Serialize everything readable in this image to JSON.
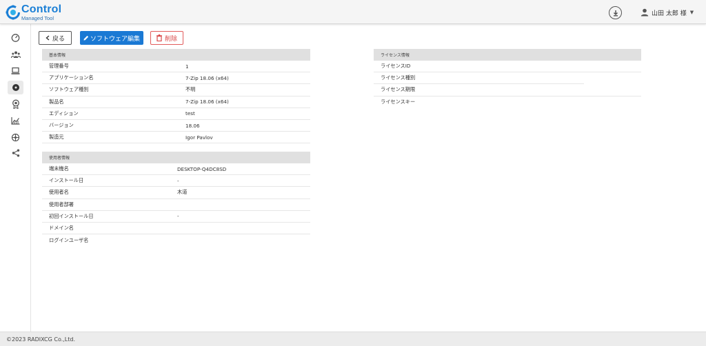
{
  "header": {
    "logo_title": "Control",
    "logo_sub": "Managed Tool",
    "user_name": "山田 太郎 様"
  },
  "colors": {
    "primary": "#1a79d4",
    "danger": "#d94848",
    "panel_head": "#e0e0e0"
  },
  "sidebar": {
    "items": [
      {
        "icon": "dashboard-gauge-icon"
      },
      {
        "icon": "users-group-icon"
      },
      {
        "icon": "laptop-icon"
      },
      {
        "icon": "software-disc-icon",
        "active": true
      },
      {
        "icon": "license-badge-icon"
      },
      {
        "icon": "report-chart-icon"
      },
      {
        "icon": "network-globe-icon"
      },
      {
        "icon": "share-icon"
      }
    ]
  },
  "toolbar": {
    "back_label": "戻る",
    "edit_label": "ソフトウェア編集",
    "delete_label": "削除"
  },
  "basic_info": {
    "title": "基本情報",
    "rows": [
      {
        "label": "管理番号",
        "value": "1"
      },
      {
        "label": "アプリケーション名",
        "value": "7-Zip 18.06 (x64)"
      },
      {
        "label": "ソフトウェア種別",
        "value": "不明"
      },
      {
        "label": "製品名",
        "value": "7-Zip 18.06 (x64)"
      },
      {
        "label": "エディション",
        "value": "test"
      },
      {
        "label": "バージョン",
        "value": "18.06"
      },
      {
        "label": "製造元",
        "value": "Igor Pavlov"
      }
    ]
  },
  "usage_info": {
    "title": "使用者情報",
    "rows": [
      {
        "label": "端末機名",
        "value": "DESKTOP-Q4DC8SD"
      },
      {
        "label": "インストール日",
        "value": "-"
      },
      {
        "label": "使用者名",
        "value": "木道"
      },
      {
        "label": "使用者部署",
        "value": ""
      },
      {
        "label": "初回インストール日",
        "value": "-"
      },
      {
        "label": "ドメイン名",
        "value": ""
      },
      {
        "label": "ログインユーザ名",
        "value": ""
      }
    ]
  },
  "license_info": {
    "title": "ライセンス情報",
    "rows": [
      {
        "label": "ライセンスID"
      },
      {
        "label": "ライセンス種別"
      },
      {
        "label": "ライセンス期限"
      },
      {
        "label": "ライセンスキー"
      }
    ]
  },
  "footer": {
    "copyright": "©2023 RADIXCG Co.,Ltd."
  }
}
